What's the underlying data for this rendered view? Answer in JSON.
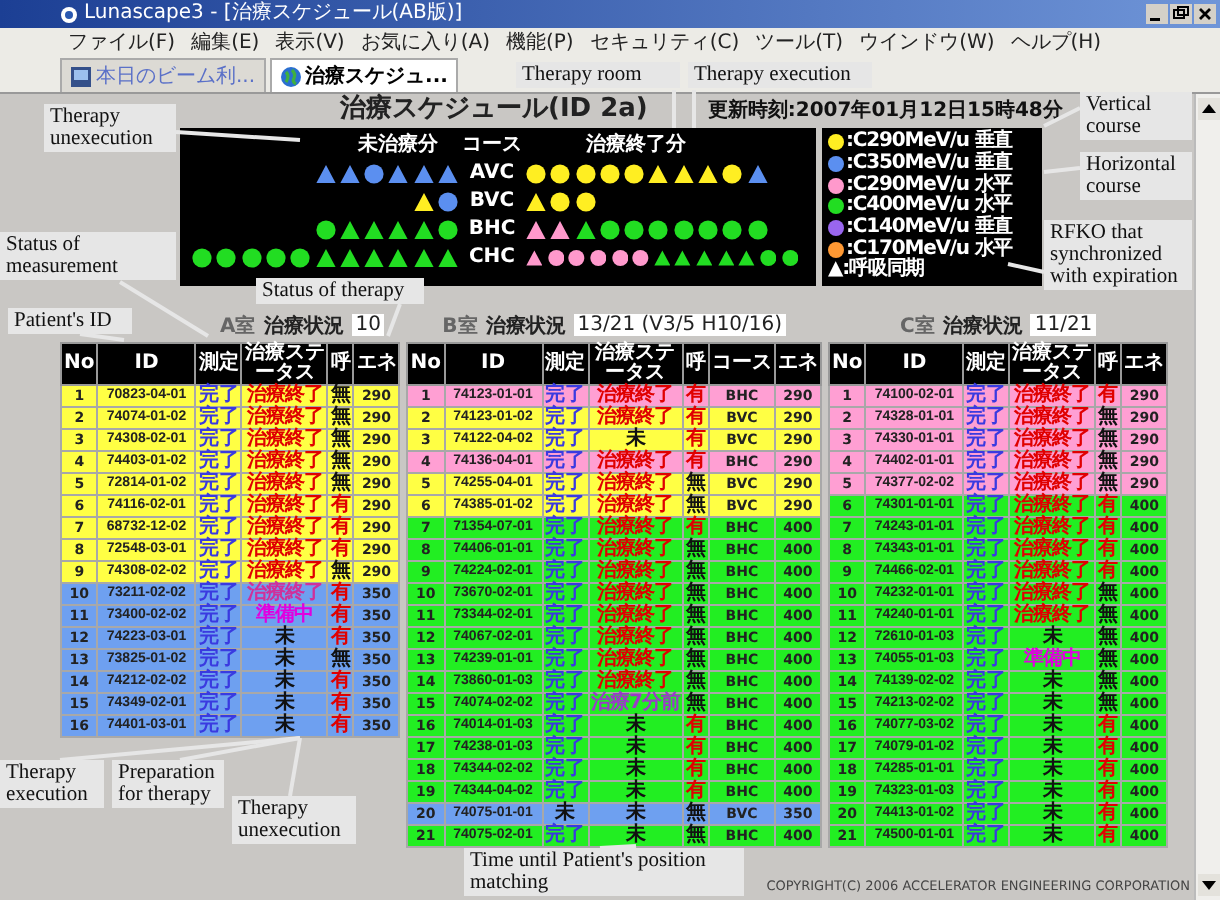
{
  "window": {
    "title": "Lunascape3 - [治療スケジュール(AB版)]"
  },
  "menu": [
    "ファイル(F)",
    "編集(E)",
    "表示(V)",
    "お気に入り(A)",
    "機能(P)",
    "セキュリティ(C)",
    "ツール(T)",
    "ウインドウ(W)",
    "ヘルプ(H)"
  ],
  "tabs": [
    {
      "label": "本日のビーム利...",
      "selected": false
    },
    {
      "label": "治療スケジュ...",
      "selected": true
    }
  ],
  "heading": {
    "title": "治療スケジュール(ID 2a)",
    "updated": "更新時刻:2007年01月12日15時48分"
  },
  "panel": {
    "headers": [
      "未治療分",
      "コース",
      "治療終了分"
    ],
    "rows": [
      {
        "course": "AVC",
        "pending": [
          {
            "kind": "triangle",
            "color": "#5b8ff0"
          },
          {
            "kind": "triangle",
            "color": "#5b8ff0"
          },
          {
            "kind": "circle",
            "color": "#5b8ff0"
          },
          {
            "kind": "triangle",
            "color": "#5b8ff0"
          },
          {
            "kind": "triangle",
            "color": "#5b8ff0"
          },
          {
            "kind": "triangle",
            "color": "#5b8ff0"
          }
        ],
        "done": [
          {
            "kind": "circle",
            "color": "#ffee22"
          },
          {
            "kind": "circle",
            "color": "#ffee22"
          },
          {
            "kind": "circle",
            "color": "#ffee22"
          },
          {
            "kind": "circle",
            "color": "#ffee22"
          },
          {
            "kind": "circle",
            "color": "#ffee22"
          },
          {
            "kind": "triangle",
            "color": "#ffee22"
          },
          {
            "kind": "triangle",
            "color": "#ffee22"
          },
          {
            "kind": "triangle",
            "color": "#ffee22"
          },
          {
            "kind": "circle",
            "color": "#ffee22"
          },
          {
            "kind": "triangle",
            "color": "#5b8ff0"
          }
        ]
      },
      {
        "course": "BVC",
        "pending": [
          {
            "kind": "triangle",
            "color": "#ffee22"
          },
          {
            "kind": "circle",
            "color": "#5b8ff0"
          }
        ],
        "done": [
          {
            "kind": "triangle",
            "color": "#ffee22"
          },
          {
            "kind": "circle",
            "color": "#ffee22"
          },
          {
            "kind": "circle",
            "color": "#ffee22"
          }
        ]
      },
      {
        "course": "BHC",
        "pending": [
          {
            "kind": "circle",
            "color": "#22dd22"
          },
          {
            "kind": "triangle",
            "color": "#22dd22"
          },
          {
            "kind": "triangle",
            "color": "#22dd22"
          },
          {
            "kind": "triangle",
            "color": "#22dd22"
          },
          {
            "kind": "triangle",
            "color": "#22dd22"
          },
          {
            "kind": "circle",
            "color": "#22dd22"
          }
        ],
        "done": [
          {
            "kind": "triangle",
            "color": "#ff99cc"
          },
          {
            "kind": "triangle",
            "color": "#ff99cc"
          },
          {
            "kind": "triangle",
            "color": "#22dd22"
          },
          {
            "kind": "circle",
            "color": "#22dd22"
          },
          {
            "kind": "circle",
            "color": "#22dd22"
          },
          {
            "kind": "circle",
            "color": "#22dd22"
          },
          {
            "kind": "circle",
            "color": "#22dd22"
          },
          {
            "kind": "circle",
            "color": "#22dd22"
          },
          {
            "kind": "circle",
            "color": "#22dd22"
          },
          {
            "kind": "circle",
            "color": "#22dd22"
          }
        ]
      },
      {
        "course": "CHC",
        "pending": [
          {
            "kind": "circle",
            "color": "#22dd22"
          },
          {
            "kind": "circle",
            "color": "#22dd22"
          },
          {
            "kind": "circle",
            "color": "#22dd22"
          },
          {
            "kind": "circle",
            "color": "#22dd22"
          },
          {
            "kind": "circle",
            "color": "#22dd22"
          },
          {
            "kind": "triangle",
            "color": "#22dd22"
          },
          {
            "kind": "triangle",
            "color": "#22dd22"
          },
          {
            "kind": "triangle",
            "color": "#22dd22"
          },
          {
            "kind": "triangle",
            "color": "#22dd22"
          },
          {
            "kind": "triangle",
            "color": "#22dd22"
          },
          {
            "kind": "triangle",
            "color": "#22dd22"
          }
        ],
        "done": [
          {
            "kind": "triangle",
            "color": "#ff99cc"
          },
          {
            "kind": "circle",
            "color": "#ff99cc"
          },
          {
            "kind": "circle",
            "color": "#ff99cc"
          },
          {
            "kind": "circle",
            "color": "#ff99cc"
          },
          {
            "kind": "circle",
            "color": "#ff99cc"
          },
          {
            "kind": "circle",
            "color": "#ff99cc"
          },
          {
            "kind": "triangle",
            "color": "#22dd22"
          },
          {
            "kind": "triangle",
            "color": "#22dd22"
          },
          {
            "kind": "triangle",
            "color": "#22dd22"
          },
          {
            "kind": "triangle",
            "color": "#22dd22"
          },
          {
            "kind": "triangle",
            "color": "#22dd22"
          },
          {
            "kind": "circle",
            "color": "#22dd22"
          },
          {
            "kind": "circle",
            "color": "#22dd22"
          }
        ]
      }
    ]
  },
  "legend": {
    "items": [
      {
        "color": "#ffee22",
        "label": ":C290MeV/u 垂直"
      },
      {
        "color": "#5b8ff0",
        "label": ":C350MeV/u 垂直"
      },
      {
        "color": "#ff99cc",
        "label": ":C290MeV/u 水平"
      },
      {
        "color": "#22dd22",
        "label": ":C400MeV/u 水平"
      },
      {
        "color": "#9966ee",
        "label": ":C140MeV/u 垂直"
      },
      {
        "color": "#ff9933",
        "label": ":C170MeV/u 水平"
      }
    ],
    "note": "▲:呼吸同期"
  },
  "tables": [
    {
      "room": "A室",
      "status_label": "治療状況",
      "status_value": "10",
      "columns": [
        {
          "kind": "no",
          "label": "No"
        },
        {
          "kind": "id",
          "label": "ID"
        },
        {
          "kind": "measure",
          "label": "測定"
        },
        {
          "kind": "status",
          "label": "治療ステータス"
        },
        {
          "kind": "breath",
          "label": "呼"
        },
        {
          "kind": "energy",
          "label": "エネ"
        }
      ],
      "rows": [
        {
          "no": "1",
          "id": "70823-04-01",
          "measure": "完了",
          "measured": true,
          "status": "治療終了",
          "kind": "done",
          "breath": "無",
          "sync": false,
          "energy": "290",
          "color": "#ffff44"
        },
        {
          "no": "2",
          "id": "74074-01-02",
          "measure": "完了",
          "measured": true,
          "status": "治療終了",
          "kind": "done",
          "breath": "無",
          "sync": false,
          "energy": "290",
          "color": "#ffff44"
        },
        {
          "no": "3",
          "id": "74308-02-01",
          "measure": "完了",
          "measured": true,
          "status": "治療終了",
          "kind": "done",
          "breath": "無",
          "sync": false,
          "energy": "290",
          "color": "#ffff44"
        },
        {
          "no": "4",
          "id": "74403-01-02",
          "measure": "完了",
          "measured": true,
          "status": "治療終了",
          "kind": "done",
          "breath": "無",
          "sync": false,
          "energy": "290",
          "color": "#ffff44"
        },
        {
          "no": "5",
          "id": "72814-01-02",
          "measure": "完了",
          "measured": true,
          "status": "治療終了",
          "kind": "done",
          "breath": "無",
          "sync": false,
          "energy": "290",
          "color": "#ffff44"
        },
        {
          "no": "6",
          "id": "74116-02-01",
          "measure": "完了",
          "measured": true,
          "status": "治療終了",
          "kind": "done",
          "breath": "有",
          "sync": true,
          "energy": "290",
          "color": "#ffff44"
        },
        {
          "no": "7",
          "id": "68732-12-02",
          "measure": "完了",
          "measured": true,
          "status": "治療終了",
          "kind": "done",
          "breath": "有",
          "sync": true,
          "energy": "290",
          "color": "#ffff44"
        },
        {
          "no": "8",
          "id": "72548-03-01",
          "measure": "完了",
          "measured": true,
          "status": "治療終了",
          "kind": "done",
          "breath": "有",
          "sync": true,
          "energy": "290",
          "color": "#ffff44"
        },
        {
          "no": "9",
          "id": "74308-02-02",
          "measure": "完了",
          "measured": true,
          "status": "治療終了",
          "kind": "done",
          "breath": "無",
          "sync": false,
          "energy": "290",
          "color": "#ffff44"
        },
        {
          "no": "10",
          "id": "73211-02-02",
          "measure": "完了",
          "measured": true,
          "status": "治療終了",
          "kind": "executing",
          "breath": "有",
          "sync": true,
          "energy": "350",
          "color": "#6ea0f0"
        },
        {
          "no": "11",
          "id": "73400-02-02",
          "measure": "完了",
          "measured": true,
          "status": "準備中",
          "kind": "preparing",
          "breath": "有",
          "sync": true,
          "energy": "350",
          "color": "#6ea0f0"
        },
        {
          "no": "12",
          "id": "74223-03-01",
          "measure": "完了",
          "measured": true,
          "status": "未",
          "kind": "waiting",
          "breath": "有",
          "sync": true,
          "energy": "350",
          "color": "#6ea0f0"
        },
        {
          "no": "13",
          "id": "73825-01-02",
          "measure": "完了",
          "measured": true,
          "status": "未",
          "kind": "waiting",
          "breath": "無",
          "sync": false,
          "energy": "350",
          "color": "#6ea0f0"
        },
        {
          "no": "14",
          "id": "74212-02-02",
          "measure": "完了",
          "measured": true,
          "status": "未",
          "kind": "waiting",
          "breath": "有",
          "sync": true,
          "energy": "350",
          "color": "#6ea0f0"
        },
        {
          "no": "15",
          "id": "74349-02-01",
          "measure": "完了",
          "measured": true,
          "status": "未",
          "kind": "waiting",
          "breath": "有",
          "sync": true,
          "energy": "350",
          "color": "#6ea0f0"
        },
        {
          "no": "16",
          "id": "74401-03-01",
          "measure": "完了",
          "measured": true,
          "status": "未",
          "kind": "waiting",
          "breath": "有",
          "sync": true,
          "energy": "350",
          "color": "#6ea0f0"
        }
      ]
    },
    {
      "room": "B室",
      "status_label": "治療状況",
      "status_value": "13/21 (V3/5 H10/16)",
      "columns": [
        {
          "kind": "no",
          "label": "No"
        },
        {
          "kind": "id",
          "label": "ID"
        },
        {
          "kind": "measure",
          "label": "測定"
        },
        {
          "kind": "status",
          "label": "治療ステータス"
        },
        {
          "kind": "breath",
          "label": "呼"
        },
        {
          "kind": "course",
          "label": "コース"
        },
        {
          "kind": "energy",
          "label": "エネ"
        }
      ],
      "rows": [
        {
          "no": "1",
          "id": "74123-01-01",
          "measure": "完了",
          "measured": true,
          "status": "治療終了",
          "kind": "done",
          "breath": "有",
          "sync": true,
          "course": "BHC",
          "energy": "290",
          "color": "#ff9fd3"
        },
        {
          "no": "2",
          "id": "74123-01-02",
          "measure": "完了",
          "measured": true,
          "status": "治療終了",
          "kind": "done",
          "breath": "有",
          "sync": true,
          "course": "BVC",
          "energy": "290",
          "color": "#ffff44"
        },
        {
          "no": "3",
          "id": "74122-04-02",
          "measure": "完了",
          "measured": true,
          "status": "未",
          "kind": "waiting",
          "breath": "有",
          "sync": true,
          "course": "BVC",
          "energy": "290",
          "color": "#ffff44"
        },
        {
          "no": "4",
          "id": "74136-04-01",
          "measure": "完了",
          "measured": true,
          "status": "治療終了",
          "kind": "done",
          "breath": "有",
          "sync": true,
          "course": "BHC",
          "energy": "290",
          "color": "#ff9fd3"
        },
        {
          "no": "5",
          "id": "74255-04-01",
          "measure": "完了",
          "measured": true,
          "status": "治療終了",
          "kind": "done",
          "breath": "無",
          "sync": false,
          "course": "BVC",
          "energy": "290",
          "color": "#ffff44"
        },
        {
          "no": "6",
          "id": "74385-01-02",
          "measure": "完了",
          "measured": true,
          "status": "治療終了",
          "kind": "done",
          "breath": "無",
          "sync": false,
          "course": "BVC",
          "energy": "290",
          "color": "#ffff44"
        },
        {
          "no": "7",
          "id": "71354-07-01",
          "measure": "完了",
          "measured": true,
          "status": "治療終了",
          "kind": "done",
          "breath": "有",
          "sync": true,
          "course": "BHC",
          "energy": "400",
          "color": "#22ee22"
        },
        {
          "no": "8",
          "id": "74406-01-01",
          "measure": "完了",
          "measured": true,
          "status": "治療終了",
          "kind": "done",
          "breath": "無",
          "sync": false,
          "course": "BHC",
          "energy": "400",
          "color": "#22ee22"
        },
        {
          "no": "9",
          "id": "74224-02-01",
          "measure": "完了",
          "measured": true,
          "status": "治療終了",
          "kind": "done",
          "breath": "無",
          "sync": false,
          "course": "BHC",
          "energy": "400",
          "color": "#22ee22"
        },
        {
          "no": "10",
          "id": "73670-02-01",
          "measure": "完了",
          "measured": true,
          "status": "治療終了",
          "kind": "done",
          "breath": "無",
          "sync": false,
          "course": "BHC",
          "energy": "400",
          "color": "#22ee22"
        },
        {
          "no": "11",
          "id": "73344-02-01",
          "measure": "完了",
          "measured": true,
          "status": "治療終了",
          "kind": "done",
          "breath": "無",
          "sync": false,
          "course": "BHC",
          "energy": "400",
          "color": "#22ee22"
        },
        {
          "no": "12",
          "id": "74067-02-01",
          "measure": "完了",
          "measured": true,
          "status": "治療終了",
          "kind": "done",
          "breath": "無",
          "sync": false,
          "course": "BHC",
          "energy": "400",
          "color": "#22ee22"
        },
        {
          "no": "13",
          "id": "74239-01-01",
          "measure": "完了",
          "measured": true,
          "status": "治療終了",
          "kind": "done",
          "breath": "無",
          "sync": false,
          "course": "BHC",
          "energy": "400",
          "color": "#22ee22"
        },
        {
          "no": "14",
          "id": "73860-01-03",
          "measure": "完了",
          "measured": true,
          "status": "治療終了",
          "kind": "done",
          "breath": "無",
          "sync": false,
          "course": "BHC",
          "energy": "400",
          "color": "#22ee22"
        },
        {
          "no": "15",
          "id": "74074-02-02",
          "measure": "完了",
          "measured": true,
          "status": "治療7分前",
          "kind": "timer",
          "breath": "無",
          "sync": false,
          "course": "BHC",
          "energy": "400",
          "color": "#22ee22"
        },
        {
          "no": "16",
          "id": "74014-01-03",
          "measure": "完了",
          "measured": true,
          "status": "未",
          "kind": "waiting",
          "breath": "有",
          "sync": true,
          "course": "BHC",
          "energy": "400",
          "color": "#22ee22"
        },
        {
          "no": "17",
          "id": "74238-01-03",
          "measure": "完了",
          "measured": true,
          "status": "未",
          "kind": "waiting",
          "breath": "有",
          "sync": true,
          "course": "BHC",
          "energy": "400",
          "color": "#22ee22"
        },
        {
          "no": "18",
          "id": "74344-02-02",
          "measure": "完了",
          "measured": true,
          "status": "未",
          "kind": "waiting",
          "breath": "有",
          "sync": true,
          "course": "BHC",
          "energy": "400",
          "color": "#22ee22"
        },
        {
          "no": "19",
          "id": "74344-04-02",
          "measure": "完了",
          "measured": true,
          "status": "未",
          "kind": "waiting",
          "breath": "有",
          "sync": true,
          "course": "BHC",
          "energy": "400",
          "color": "#22ee22"
        },
        {
          "no": "20",
          "id": "74075-01-01",
          "measure": "未",
          "measured": false,
          "status": "未",
          "kind": "waiting",
          "breath": "無",
          "sync": false,
          "course": "BVC",
          "energy": "350",
          "color": "#6ea0f0"
        },
        {
          "no": "21",
          "id": "74075-02-01",
          "measure": "完了",
          "measured": true,
          "status": "未",
          "kind": "waiting",
          "breath": "無",
          "sync": false,
          "course": "BHC",
          "energy": "400",
          "color": "#22ee22"
        }
      ]
    },
    {
      "room": "C室",
      "status_label": "治療状況",
      "status_value": "11/21",
      "columns": [
        {
          "kind": "no",
          "label": "No"
        },
        {
          "kind": "id",
          "label": "ID"
        },
        {
          "kind": "measure",
          "label": "測定"
        },
        {
          "kind": "status",
          "label": "治療ステータス"
        },
        {
          "kind": "breath",
          "label": "呼"
        },
        {
          "kind": "energy",
          "label": "エネ"
        }
      ],
      "rows": [
        {
          "no": "1",
          "id": "74100-02-01",
          "measure": "完了",
          "measured": true,
          "status": "治療終了",
          "kind": "done",
          "breath": "有",
          "sync": true,
          "energy": "290",
          "color": "#ff9fd3"
        },
        {
          "no": "2",
          "id": "74328-01-01",
          "measure": "完了",
          "measured": true,
          "status": "治療終了",
          "kind": "done",
          "breath": "無",
          "sync": false,
          "energy": "290",
          "color": "#ff9fd3"
        },
        {
          "no": "3",
          "id": "74330-01-01",
          "measure": "完了",
          "measured": true,
          "status": "治療終了",
          "kind": "done",
          "breath": "無",
          "sync": false,
          "energy": "290",
          "color": "#ff9fd3"
        },
        {
          "no": "4",
          "id": "74402-01-01",
          "measure": "完了",
          "measured": true,
          "status": "治療終了",
          "kind": "done",
          "breath": "無",
          "sync": false,
          "energy": "290",
          "color": "#ff9fd3"
        },
        {
          "no": "5",
          "id": "74377-02-02",
          "measure": "完了",
          "measured": true,
          "status": "治療終了",
          "kind": "done",
          "breath": "無",
          "sync": false,
          "energy": "290",
          "color": "#ff9fd3"
        },
        {
          "no": "6",
          "id": "74301-01-01",
          "measure": "完了",
          "measured": true,
          "status": "治療終了",
          "kind": "done",
          "breath": "有",
          "sync": true,
          "energy": "400",
          "color": "#22ee22"
        },
        {
          "no": "7",
          "id": "74243-01-01",
          "measure": "完了",
          "measured": true,
          "status": "治療終了",
          "kind": "done",
          "breath": "有",
          "sync": true,
          "energy": "400",
          "color": "#22ee22"
        },
        {
          "no": "8",
          "id": "74343-01-01",
          "measure": "完了",
          "measured": true,
          "status": "治療終了",
          "kind": "done",
          "breath": "有",
          "sync": true,
          "energy": "400",
          "color": "#22ee22"
        },
        {
          "no": "9",
          "id": "74466-02-01",
          "measure": "完了",
          "measured": true,
          "status": "治療終了",
          "kind": "done",
          "breath": "有",
          "sync": true,
          "energy": "400",
          "color": "#22ee22"
        },
        {
          "no": "10",
          "id": "74232-01-01",
          "measure": "完了",
          "measured": true,
          "status": "治療終了",
          "kind": "done",
          "breath": "無",
          "sync": false,
          "energy": "400",
          "color": "#22ee22"
        },
        {
          "no": "11",
          "id": "74240-01-01",
          "measure": "完了",
          "measured": true,
          "status": "治療終了",
          "kind": "done",
          "breath": "無",
          "sync": false,
          "energy": "400",
          "color": "#22ee22"
        },
        {
          "no": "12",
          "id": "72610-01-03",
          "measure": "完了",
          "measured": true,
          "status": "未",
          "kind": "waiting",
          "breath": "無",
          "sync": false,
          "energy": "400",
          "color": "#22ee22"
        },
        {
          "no": "13",
          "id": "74055-01-03",
          "measure": "完了",
          "measured": true,
          "status": "準備中",
          "kind": "preparing",
          "breath": "無",
          "sync": false,
          "energy": "400",
          "color": "#22ee22"
        },
        {
          "no": "14",
          "id": "74139-02-02",
          "measure": "完了",
          "measured": true,
          "status": "未",
          "kind": "waiting",
          "breath": "無",
          "sync": false,
          "energy": "400",
          "color": "#22ee22"
        },
        {
          "no": "15",
          "id": "74213-02-02",
          "measure": "完了",
          "measured": true,
          "status": "未",
          "kind": "waiting",
          "breath": "無",
          "sync": false,
          "energy": "400",
          "color": "#22ee22"
        },
        {
          "no": "16",
          "id": "74077-03-02",
          "measure": "完了",
          "measured": true,
          "status": "未",
          "kind": "waiting",
          "breath": "有",
          "sync": true,
          "energy": "400",
          "color": "#22ee22"
        },
        {
          "no": "17",
          "id": "74079-01-02",
          "measure": "完了",
          "measured": true,
          "status": "未",
          "kind": "waiting",
          "breath": "有",
          "sync": true,
          "energy": "400",
          "color": "#22ee22"
        },
        {
          "no": "18",
          "id": "74285-01-01",
          "measure": "完了",
          "measured": true,
          "status": "未",
          "kind": "waiting",
          "breath": "有",
          "sync": true,
          "energy": "400",
          "color": "#22ee22"
        },
        {
          "no": "19",
          "id": "74323-01-03",
          "measure": "完了",
          "measured": true,
          "status": "未",
          "kind": "waiting",
          "breath": "有",
          "sync": true,
          "energy": "400",
          "color": "#22ee22"
        },
        {
          "no": "20",
          "id": "74413-01-02",
          "measure": "完了",
          "measured": true,
          "status": "未",
          "kind": "waiting",
          "breath": "有",
          "sync": true,
          "energy": "400",
          "color": "#22ee22"
        },
        {
          "no": "21",
          "id": "74500-01-01",
          "measure": "完了",
          "measured": true,
          "status": "未",
          "kind": "waiting",
          "breath": "有",
          "sync": true,
          "energy": "400",
          "color": "#22ee22"
        }
      ]
    }
  ],
  "footer": "COPYRIGHT(C) 2006 ACCELERATOR ENGINEERING CORPORATION",
  "annotations": [
    {
      "text": "Therapy room"
    },
    {
      "text": "Therapy execution"
    },
    {
      "text": "Therapy unexecution"
    },
    {
      "text": "Vertical course"
    },
    {
      "text": "Horizontal course"
    },
    {
      "text": "Status of measurement"
    },
    {
      "text": "RFKO that synchronized with expiration"
    },
    {
      "text": "Patient's ID"
    },
    {
      "text": "Status of therapy"
    },
    {
      "text": "Therapy execution"
    },
    {
      "text": "Preparation for therapy"
    },
    {
      "text": "Therapy unexecution"
    },
    {
      "text": "Time until Patient's position matching"
    }
  ]
}
